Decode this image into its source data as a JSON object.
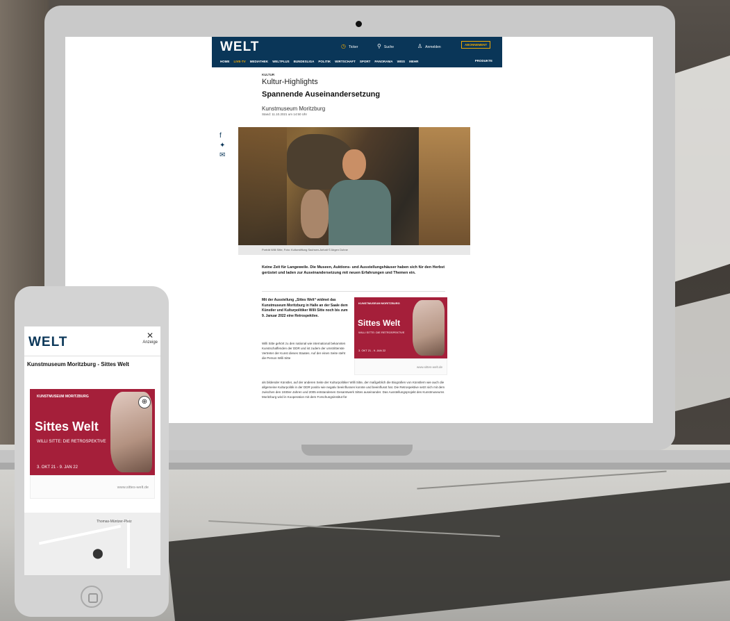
{
  "desktop": {
    "logo": "WELT",
    "header": {
      "ticker": "Ticker",
      "search": "Suche",
      "login": "Anmelden",
      "abo": "ABONNEMENT"
    },
    "nav": [
      "HOME",
      "LIVE-TV",
      "MEDIATHEK",
      "WELTPLUS",
      "BUNDESLIGA",
      "POLITIK",
      "WIRTSCHAFT",
      "SPORT",
      "PANORAMA",
      "WISS",
      "MEHR"
    ],
    "products": "PRODUKTE",
    "article": {
      "kicker": "KULTUR",
      "category": "Kultur-Highlights",
      "headline": "Spannende Auseinandersetzung",
      "source": "Kunstmuseum Moritzburg",
      "stand": "Stand: 11.10.2021 um 14:50 Uhr",
      "caption": "Porträt Willi Sitte, Foto: Kulturstiftung Sachsen-Anhalt ©Jürgen Dohne",
      "lead": "Keine Zeit für Langeweile. Die Museen, Auktions- und Ausstellungshäuser haben sich für den Herbst gerüstet und laden zur Auseinandersetzung mit neuen Erfahrungen und Themen ein.",
      "para_bold": "Mit der Ausstellung „Sittes Welt“ widmet das Kunstmuseum Moritzburg in Halle an der Saale dem Künstler und Kulturpolitiker Willi Sitte noch bis zum 9. Januar 2022 eine Retrospektive.",
      "para_small": "Willi Sitte gehört zu den national wie international bekannten Kunstschaffenden der DDR und ist zudem der umstrittenste Vertreter der Kunst dieses Staates. Auf der einen Seite steht die Person Willi Sitte",
      "para_wide": "als bildender Künstler, auf der anderen Seite der Kulturpolitiker Willi Sitte, der maßgeblich die Biografien von Künstlern wie auch die allgemeine Kulturpolitik in der DDR positiv wie negativ beeinflussen konnte und beeinflusst hat. Die Retrospektive setzt sich mit dem zwischen den 1930er-Jahren und 2005 entstandenen Gesamtwerk Sittes auseinander. Das Ausstellungsprojekt des Kunstmuseums Moritzburg wird in Kooperation mit dem Forschungsinstitut für"
    },
    "ad": {
      "museum": "KUNSTMUSEUM MORITZBURG",
      "title": "Sittes Welt",
      "subtitle": "WILLI SITTE: DIE RETROSPEKTIVE",
      "dates": "3. OKT 21 - 9. JAN 22",
      "url": "www.sittes-welt.de"
    }
  },
  "mobile": {
    "logo": "WELT",
    "close": "✕",
    "anzeige": "Anzeige",
    "title": "Kunstmuseum Moritzburg - Sittes Welt",
    "ad": {
      "museum": "KUNSTMUSEUM MORITZBURG",
      "title": "Sittes Welt",
      "subtitle": "WILLI SITTE: DIE RETROSPEKTIVE",
      "dates": "3. OKT 21 - 9. JAN 22",
      "url": "www.sittes-welt.de"
    },
    "map_label": "Thomas-Müntzer-Platz"
  },
  "colors": {
    "welt_blue": "#0a3658",
    "ad_red": "#a51f3a",
    "abo_orange": "#f2a900"
  },
  "icons": {
    "ticker": "clock-icon",
    "search": "search-icon",
    "login": "user-icon",
    "facebook": "facebook-icon",
    "twitter": "twitter-icon",
    "mail": "mail-icon",
    "map_pin": "map-pin-icon",
    "zoom": "zoom-in-icon"
  }
}
